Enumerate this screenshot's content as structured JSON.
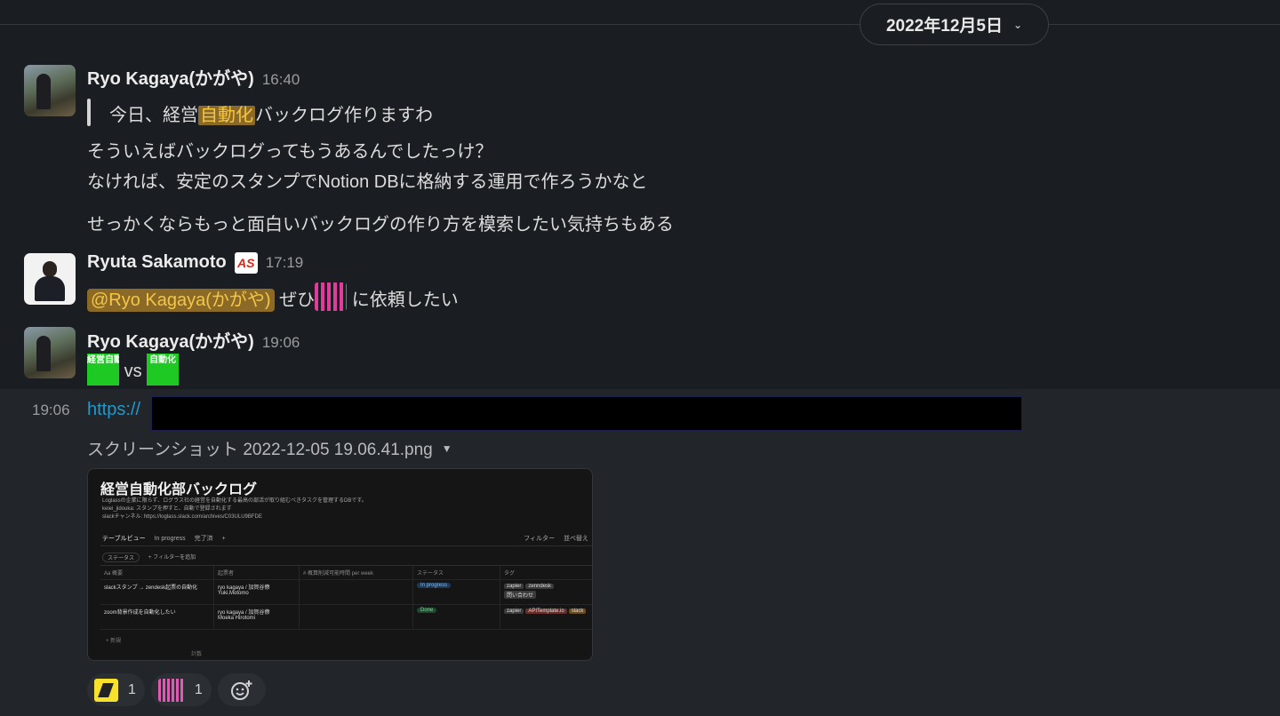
{
  "date_divider": {
    "label": "2022年12月5日"
  },
  "messages": [
    {
      "author": "Ryo Kagaya(かがや)",
      "time": "16:40",
      "quote_pre": "今日、経営",
      "quote_highlight": "自動化",
      "quote_post": "バックログ作りますわ",
      "line1": "そういえばバックログってもうあるんでしたっけ？",
      "line2": "なければ、安定のスタンプでNotion DBに格納する運用で作ろうかなと",
      "line3": "せっかくならもっと面白いバックログの作り方を模索したい気持ちもある"
    },
    {
      "author": "Ryuta Sakamoto",
      "badge": "AS",
      "time": "17:19",
      "mention": "@Ryo Kagaya(かがや)",
      "text_pre": " ぜひ",
      "text_post": " に依頼したい"
    },
    {
      "author": "Ryo Kagaya(かがや)",
      "time": "19:06",
      "emoji_left_text": "経営自動化部",
      "vs": "vs",
      "emoji_right_text": "自動化"
    }
  ],
  "followup": {
    "time": "19:06",
    "link": "https://",
    "file_name": "スクリーンショット 2022-12-05 19.06.41.png"
  },
  "screenshot": {
    "title": "経営自動化部バックログ",
    "desc1": "Loglassの企業に限らず、ログラス社の経営を自動化する最高の部活が取り組むべきタスクを管理するDBです。",
    "desc2": "keiei_jidouka: スタンプを押すと、自動で登録されます",
    "desc3": "slackチャンネル: https://loglass.slack.com/archives/C03ULU9BFDE",
    "tabs": [
      "テーブルビュー",
      "In progress",
      "完了済",
      "+"
    ],
    "filter": "フィルター",
    "sort": "並べ替え",
    "status_filter": "ステータス",
    "add_filter": "+ フィルターを追加",
    "headers": [
      "Aa 概要",
      "起票者",
      "# 概算削減可能時間 per week",
      "ステータス",
      "タグ"
    ],
    "rows": [
      {
        "title": "slackスタンプ → zendesk起票の自動化",
        "people": [
          "ryo kagaya / 加賀谷僚",
          "Yuki.Motomo"
        ],
        "status": "In progress",
        "tags": [
          "zapier",
          "zenndesk",
          "問い合わせ"
        ]
      },
      {
        "title": "zoom背景作成を自動化したい",
        "people": [
          "ryo kagaya / 加賀谷僚",
          "Moeka Hirotomi"
        ],
        "status": "Done",
        "tags": [
          "zapier",
          "APITemplate.io",
          "slack"
        ]
      }
    ],
    "new": "+ 新規",
    "count": "計数"
  },
  "reactions": [
    {
      "emoji": "yellow-stamp-icon",
      "count": "1"
    },
    {
      "emoji": "pink-stamp-icon",
      "count": "1"
    }
  ],
  "colors": {
    "background": "#1a1d21",
    "link": "#1d9bd1",
    "highlight_bg": "#8a6a26",
    "highlight_text": "#f5c646"
  }
}
